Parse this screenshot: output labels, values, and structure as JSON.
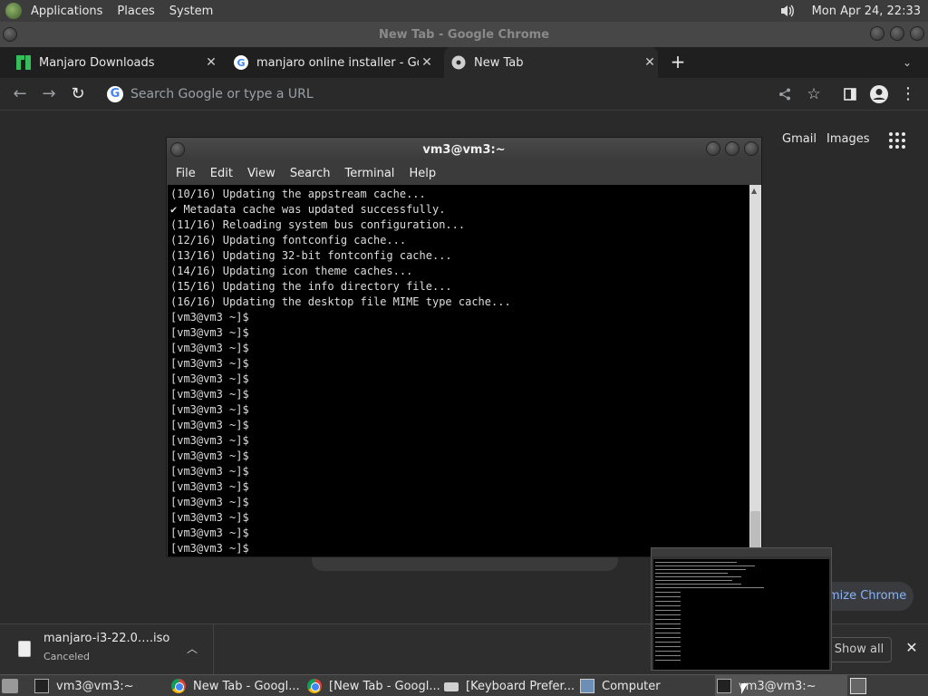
{
  "top_panel": {
    "applications": "Applications",
    "places": "Places",
    "system": "System",
    "clock": "Mon Apr 24, 22:33",
    "volume_icon": "speaker-icon"
  },
  "chrome": {
    "window_title": "New Tab - Google Chrome",
    "tabs": [
      {
        "title": "Manjaro Downloads",
        "icon": "manjaro-icon"
      },
      {
        "title": "manjaro online installer - Goog",
        "icon": "google-icon"
      },
      {
        "title": "New Tab",
        "icon": "chrome-icon"
      }
    ],
    "omnibox_placeholder": "Search Google or type a URL",
    "gmail": "Gmail",
    "images": "Images",
    "customize": "mize Chrome",
    "colors": {
      "accent": "#8ab4f8"
    }
  },
  "download": {
    "file_name": "manjaro-i3-22.0….iso",
    "status": "Canceled",
    "show_all": "Show all"
  },
  "terminal": {
    "title": "vm3@vm3:~",
    "menu": [
      "File",
      "Edit",
      "View",
      "Search",
      "Terminal",
      "Help"
    ],
    "lines": [
      "(10/16) Updating the appstream cache...",
      "✔ Metadata cache was updated successfully.",
      "(11/16) Reloading system bus configuration...",
      "(12/16) Updating fontconfig cache...",
      "(13/16) Updating 32-bit fontconfig cache...",
      "(14/16) Updating icon theme caches...",
      "(15/16) Updating the info directory file...",
      "(16/16) Updating the desktop file MIME type cache...",
      "[vm3@vm3 ~]$",
      "[vm3@vm3 ~]$",
      "[vm3@vm3 ~]$",
      "[vm3@vm3 ~]$",
      "[vm3@vm3 ~]$",
      "[vm3@vm3 ~]$",
      "[vm3@vm3 ~]$",
      "[vm3@vm3 ~]$",
      "[vm3@vm3 ~]$",
      "[vm3@vm3 ~]$",
      "[vm3@vm3 ~]$",
      "[vm3@vm3 ~]$",
      "[vm3@vm3 ~]$",
      "[vm3@vm3 ~]$",
      "[vm3@vm3 ~]$",
      "[vm3@vm3 ~]$"
    ]
  },
  "taskbar": {
    "items": [
      {
        "label": "vm3@vm3:~",
        "icon": "terminal-icon"
      },
      {
        "label": "New Tab - Googl...",
        "icon": "chrome-icon"
      },
      {
        "label": "[New Tab - Googl...",
        "icon": "chrome-icon"
      },
      {
        "label": "[Keyboard Prefer...",
        "icon": "keyboard-icon"
      },
      {
        "label": "Computer",
        "icon": "computer-icon"
      },
      {
        "label": "vm3@vm3:~",
        "icon": "terminal-icon"
      }
    ]
  }
}
